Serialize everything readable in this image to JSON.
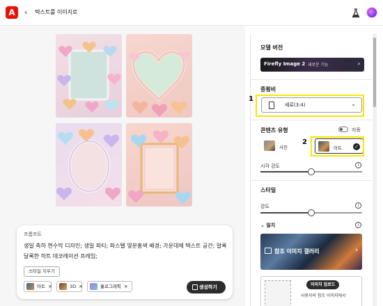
{
  "header": {
    "logo_label": "A",
    "back_icon": "chevron-left-icon",
    "title": "텍스트를 이미지로"
  },
  "prompt": {
    "label": "프롬프트",
    "text": "생일 축하 현수막 디자인; 생일 파티; 파스텔 옆분홍색 배경; 가운데에 텍스트 공간; 알록달록한 하트 데코레이션 프레임;",
    "clear_style": "스타일 지우기",
    "tags": [
      {
        "label": "아트"
      },
      {
        "label": "3D"
      },
      {
        "label": "홀로그래픽"
      }
    ],
    "generate": "생성하기"
  },
  "panel": {
    "model_title": "모델 버전",
    "model_name": "Firefly Image 2",
    "model_badge": "새로운 기능",
    "ratio_title": "종횡비",
    "ratio_value": "세로(3:4)",
    "ctype_title": "콘텐츠 유형",
    "auto_label": "자동",
    "ctype_photo": "사진",
    "ctype_art": "아트",
    "visual_strength": "시각 강도",
    "visual_strength_value": 0.5,
    "style_title": "스타일",
    "intensity": "강도",
    "intensity_value": 0.5,
    "effect": "일치",
    "ref_gallery": "참조 이미지 갤러리",
    "upload_btn": "이미지 업로드",
    "upload_desc": "사용자의 참조 이미지에서"
  },
  "annotations": {
    "one": "1",
    "two": "2"
  },
  "colors": {
    "highlight": "#f5e800",
    "brand": "#eb1000",
    "button_dark": "#2c2c2c"
  }
}
